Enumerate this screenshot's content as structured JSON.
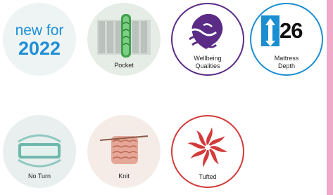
{
  "badges": {
    "new": {
      "line1": "new for",
      "line2": "2022"
    },
    "pocket": {
      "label": "Pocket"
    },
    "wellbeing": {
      "label_line1": "Wellbeing",
      "label_line2": "Qualities"
    },
    "mattress": {
      "number": "26",
      "label_line1": "Mattress",
      "label_line2": "Depth"
    },
    "noturn": {
      "label": "No Turn"
    },
    "knit": {
      "label": "Knit"
    },
    "tufted": {
      "label": "Tufted"
    }
  },
  "colors": {
    "blue": "#1f8fd6",
    "purple": "#5a2c86",
    "red": "#d33a3a",
    "pink_stripe": "#f0a9c8"
  }
}
